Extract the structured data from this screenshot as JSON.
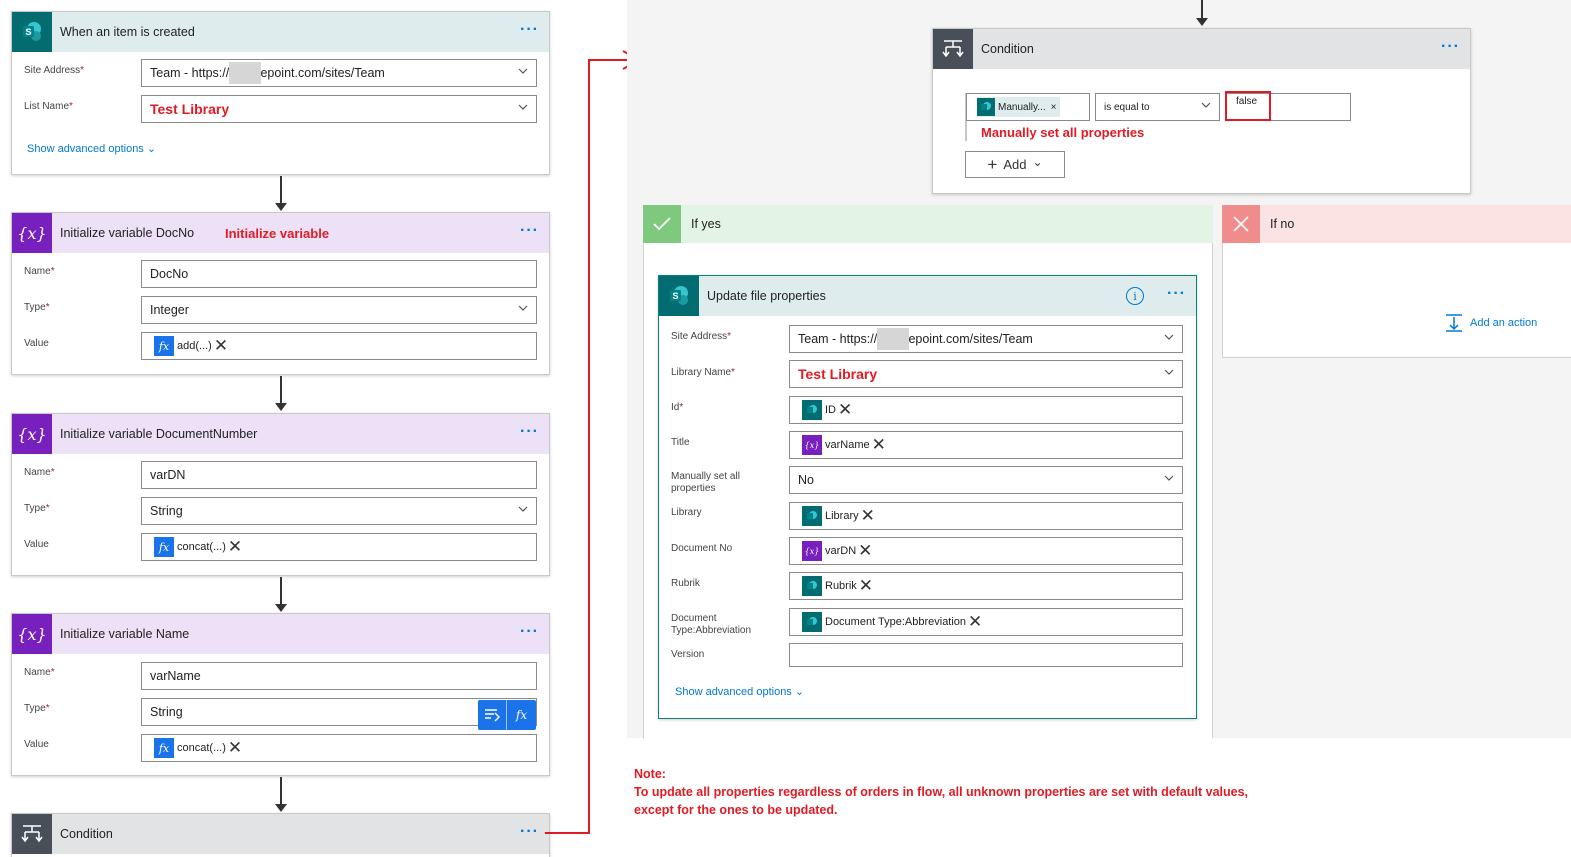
{
  "trigger": {
    "title": "When an item is created",
    "site_label": "Site Address",
    "site_value": "Team - https://        .sharepoint.com/sites/Team",
    "list_label": "List Name",
    "list_value": "Test Library",
    "advanced": "Show advanced options"
  },
  "init_docno": {
    "title": "Initialize variable DocNo",
    "annotation": "Initialize variable",
    "name_label": "Name",
    "name_value": "DocNo",
    "type_label": "Type",
    "type_value": "Integer",
    "value_label": "Value",
    "value_token": "add(...)"
  },
  "init_docnumber": {
    "title": "Initialize variable DocumentNumber",
    "name_label": "Name",
    "name_value": "varDN",
    "type_label": "Type",
    "type_value": "String",
    "value_label": "Value",
    "value_token": "concat(...)"
  },
  "init_name": {
    "title": "Initialize variable Name",
    "name_label": "Name",
    "name_value": "varName",
    "type_label": "Type",
    "type_value": "String",
    "value_label": "Value",
    "value_token": "concat(...)"
  },
  "condition_bottom": {
    "title": "Condition"
  },
  "condition_top": {
    "title": "Condition",
    "left_token": "Manually...",
    "operator": "is equal to",
    "right_value": "false",
    "annotation": "Manually set all properties",
    "add_label": "Add"
  },
  "if_yes": {
    "title": "If yes"
  },
  "if_no": {
    "title": "If no",
    "add_action": "Add an action"
  },
  "update": {
    "title": "Update file properties",
    "site_label": "Site Address",
    "site_value": "Team - https://        .sharepoint.com/sites/Team",
    "library_label": "Library Name",
    "library_value": "Test Library",
    "id_label": "Id",
    "id_token": "ID",
    "title_label": "Title",
    "title_token": "varName",
    "manual_label": "Manually set all properties",
    "manual_value": "No",
    "lib_label": "Library",
    "lib_token": "Library",
    "docno_label": "Document No",
    "docno_token": "varDN",
    "rubrik_label": "Rubrik",
    "rubrik_token": "Rubrik",
    "doctype_label": "Document Type:Abbreviation",
    "doctype_token": "Document Type:Abbreviation",
    "version_label": "Version",
    "advanced": "Show advanced options"
  },
  "note": {
    "title": "Note:",
    "line1": "To update all properties regardless of orders in flow, all unknown properties are set with default values,",
    "line2": "except for the ones to be updated."
  },
  "colors": {
    "sharepoint": "#036c70",
    "variable": "#7720bd",
    "condition": "#484f58",
    "accent": "#0078d4",
    "annotation_red": "#e01b24"
  }
}
